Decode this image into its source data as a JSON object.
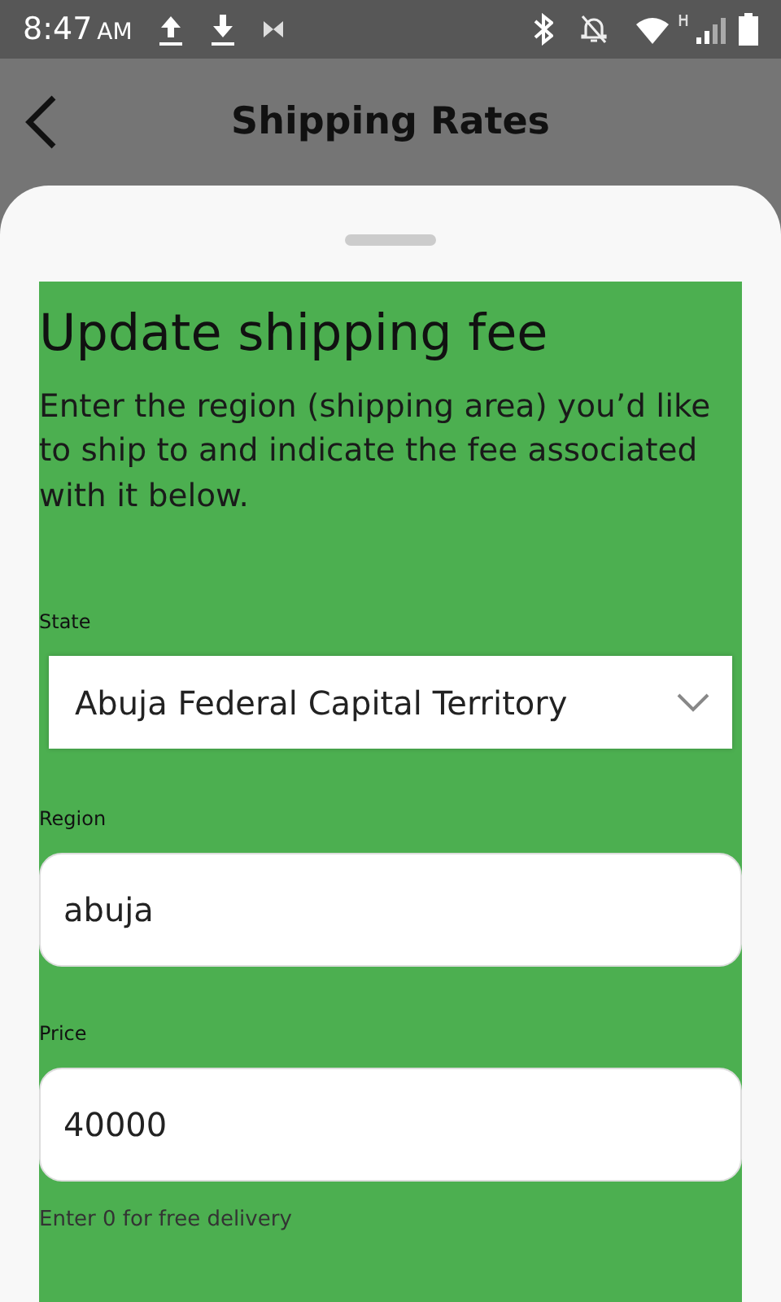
{
  "status_bar": {
    "time": "8:47",
    "meridiem": "AM"
  },
  "app_bar": {
    "title": "Shipping Rates"
  },
  "form": {
    "heading": "Update shipping fee",
    "description": "Enter the region (shipping area) you’d like to ship to and indicate the fee associated with it below.",
    "fields": [
      {
        "kind": "select",
        "label": "State",
        "value": "Abuja Federal Capital Territory"
      },
      {
        "kind": "text",
        "label": "Region",
        "value": "abuja"
      },
      {
        "kind": "text",
        "label": "Price",
        "value": "40000",
        "helper": "Enter 0 for free delivery"
      }
    ]
  }
}
